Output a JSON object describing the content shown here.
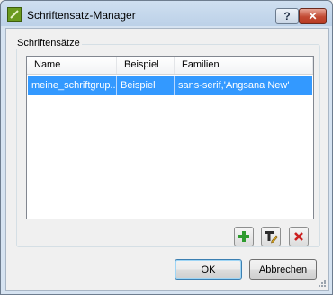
{
  "window": {
    "title": "Schriftensatz-Manager",
    "help_label": "?",
    "close_label": "✕"
  },
  "group": {
    "label": "Schriftensätze"
  },
  "table": {
    "columns": [
      "Name",
      "Beispiel",
      "Familien"
    ],
    "rows": [
      {
        "name": "meine_schriftgrup...",
        "example": "Beispiel",
        "families": "sans-serif,'Angsana New'"
      }
    ]
  },
  "buttons": {
    "ok": "OK",
    "cancel": "Abbrechen"
  },
  "icons": [
    "add-icon",
    "edit-font-icon",
    "delete-icon"
  ],
  "colors": {
    "selection": "#3399ff",
    "add": "#2e9b2e",
    "delete": "#cc2020"
  }
}
